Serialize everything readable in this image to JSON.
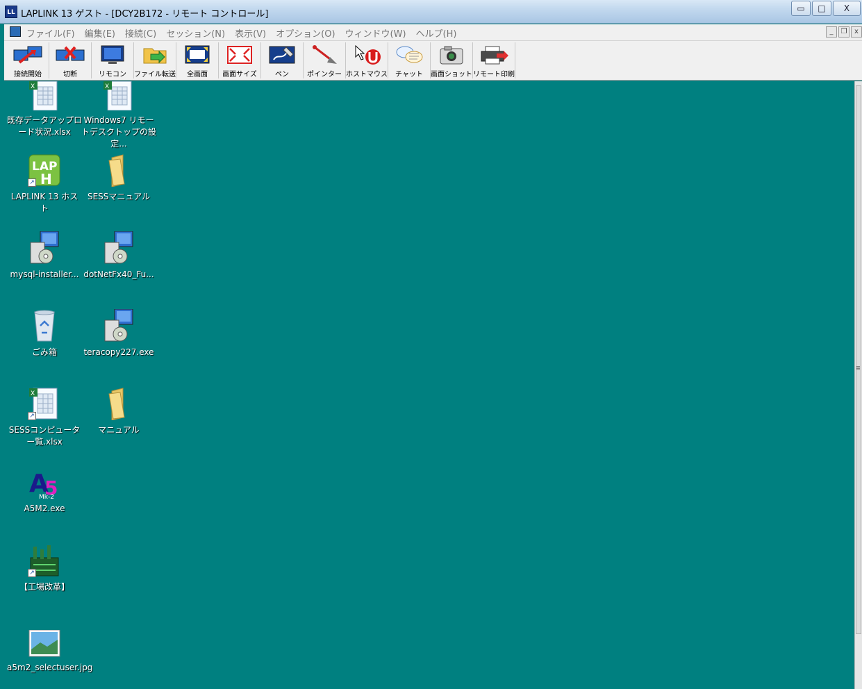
{
  "window": {
    "app_icon_text": "LL",
    "title": "LAPLINK 13 ゲスト - [DCY2B172 - リモート コントロール]",
    "min_symbol": "▭",
    "max_symbol": "□",
    "close_symbol": "X"
  },
  "menu": {
    "items": [
      "ファイル(F)",
      "編集(E)",
      "接続(C)",
      "セッション(N)",
      "表示(V)",
      "オプション(O)",
      "ウィンドウ(W)",
      "ヘルプ(H)"
    ],
    "mdi_min": "_",
    "mdi_restore": "❐",
    "mdi_close": "x"
  },
  "toolbar": {
    "tools": [
      {
        "label": "接続開始",
        "icon": "connect-icon"
      },
      {
        "label": "切断",
        "icon": "disconnect-icon"
      },
      {
        "label": "リモコン",
        "icon": "remote-control-icon"
      },
      {
        "label": "ファイル転送",
        "icon": "file-transfer-icon"
      },
      {
        "label": "全画面",
        "icon": "fullscreen-icon"
      },
      {
        "label": "画面サイズ",
        "icon": "screen-size-icon"
      },
      {
        "label": "ペン",
        "icon": "pen-icon"
      },
      {
        "label": "ポインター",
        "icon": "pointer-icon"
      },
      {
        "label": "ホストマウス",
        "icon": "host-mouse-icon"
      },
      {
        "label": "チャット",
        "icon": "chat-icon"
      },
      {
        "label": "画面ショット",
        "icon": "screenshot-icon"
      },
      {
        "label": "リモート印刷",
        "icon": "remote-print-icon"
      }
    ]
  },
  "desktop": {
    "icons": [
      {
        "label": "既存データアップロード状況.xlsx",
        "icon": "excel-file-icon"
      },
      {
        "label": "Windows7 リモートデスクトップの設定...",
        "icon": "excel-file-icon"
      },
      {
        "label": "LAPLINK 13 ホスト",
        "icon": "laplink-host-icon"
      },
      {
        "label": "SESSマニュアル",
        "icon": "folder-icon"
      },
      {
        "label": "mysql-installer...",
        "icon": "installer-icon"
      },
      {
        "label": "dotNetFx40_Fu...",
        "icon": "installer-icon"
      },
      {
        "label": "ごみ箱",
        "icon": "recycle-bin-icon"
      },
      {
        "label": "teracopy227.exe",
        "icon": "installer-icon"
      },
      {
        "label": "SESSコンピューター覧.xlsx",
        "icon": "excel-file-icon"
      },
      {
        "label": "マニュアル",
        "icon": "folder-icon"
      },
      {
        "label": "A5M2.exe",
        "icon": "a5m2-icon"
      },
      {
        "label": "【工場改革】",
        "icon": "factory-icon"
      },
      {
        "label": "a5m2_selectuser.jpg",
        "icon": "image-file-icon"
      }
    ]
  },
  "colors": {
    "desktop_bg": "#008080",
    "titlebar_top": "#d9e8f6",
    "toolbar_bg": "#f0f0f0"
  }
}
